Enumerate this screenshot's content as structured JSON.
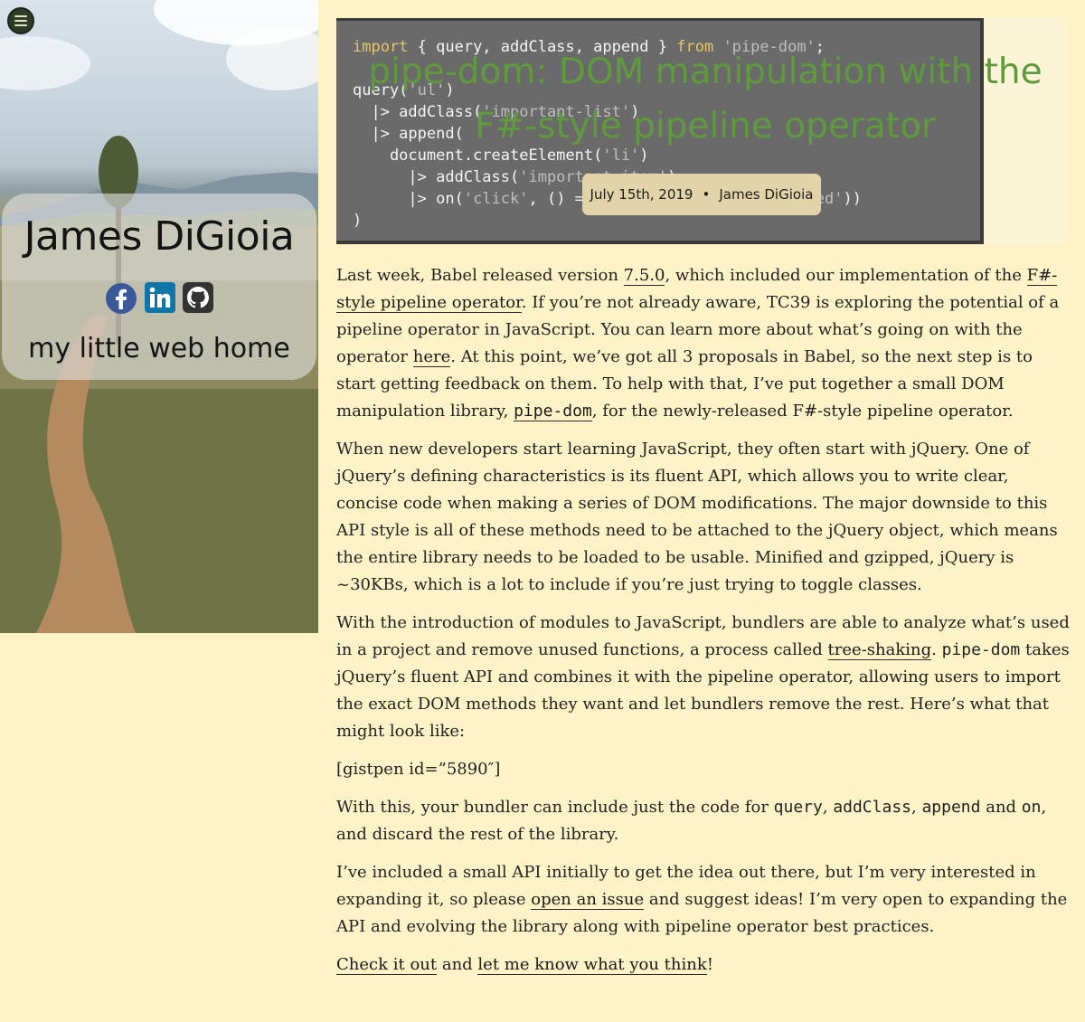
{
  "sidebar": {
    "name": "James DiGioia",
    "tagline": "my little web home",
    "menu_icon": "hamburger-icon",
    "socials": [
      {
        "icon": "facebook-icon",
        "color": "#3b5998"
      },
      {
        "icon": "linkedin-icon",
        "color": "#0e76a8"
      },
      {
        "icon": "github-icon",
        "color": "#333333"
      }
    ]
  },
  "header": {
    "title": "pipe-dom: DOM manipulation with the F#-style pipeline operator",
    "date": "July 15th, 2019",
    "separator": "•",
    "author": "James DiGioia",
    "code_lines": [
      "import { query, addClass, append } from 'pipe-dom';",
      "",
      "query('ul')",
      "  |> addClass('important-list')",
      "  |> append(",
      "    document.createElement('li')",
      "      |> addClass('important-item')",
      "      |> on('click', () => console.log('item clicked'))",
      ")"
    ]
  },
  "colors": {
    "background": "#fef3c7",
    "title_green": "#5f9a3c",
    "code_bg": "#6a6a6a",
    "meta_bg": "#e2d4a8"
  },
  "article": {
    "p1": {
      "t1": "Last week, Babel released version ",
      "l1": "7.5.0",
      "t2": ", which included our implementation of the ",
      "l2": "F#-style pipeline operator",
      "t3": ". If you’re not already aware, TC39 is exploring the potential of a pipeline operator in JavaScript. You can learn more about what’s going on with the operator ",
      "l3": "here",
      "t4": ". At this point, we’ve got all 3 proposals in Babel, so the next step is to start getting feedback on them. To help with that, I’ve put together a small DOM manipulation library, ",
      "l4": "pipe-dom",
      "t5": ", for the newly-released F#-style pipeline operator."
    },
    "p2": "When new developers start learning JavaScript, they often start with jQuery. One of jQuery’s defining characteristics is its fluent API, which allows you to write clear, concise code when making a series of DOM modifications. The major downside to this API style is all of these methods need to be attached to the jQuery object, which means the entire library needs to be loaded to be usable. Minified and gzipped, jQuery is ~30KBs, which is a lot to include if you’re just trying to toggle classes.",
    "p3": {
      "t1": "With the introduction of modules to JavaScript, bundlers are able to analyze what’s used in a project and remove unused functions, a process called ",
      "l1": "tree-shaking",
      "t2": ". ",
      "c1": "pipe-dom",
      "t3": " takes jQuery’s fluent API and combines it with the pipeline operator, allowing users to import the exact DOM methods they want and let bundlers remove the rest. Here’s what that might look like:"
    },
    "p4": "[gistpen id=”5890″]",
    "p5": {
      "t1": "With this, your bundler can include just the code for ",
      "c1": "query",
      "s1": ", ",
      "c2": "addClass",
      "s2": ", ",
      "c3": "append",
      "t2": " and ",
      "c4": "on",
      "t3": ", and discard the rest of the library."
    },
    "p6": {
      "t1": "I’ve included a small API initially to get the idea out there, but I’m very interested in expanding it, so please ",
      "l1": "open an issue",
      "t2": " and suggest ideas! I’m very open to expanding the API and evolving the library along with pipeline operator best practices."
    },
    "p7": {
      "l1": "Check it out",
      "t1": " and ",
      "l2": "let me know what you think",
      "t2": "!"
    }
  }
}
